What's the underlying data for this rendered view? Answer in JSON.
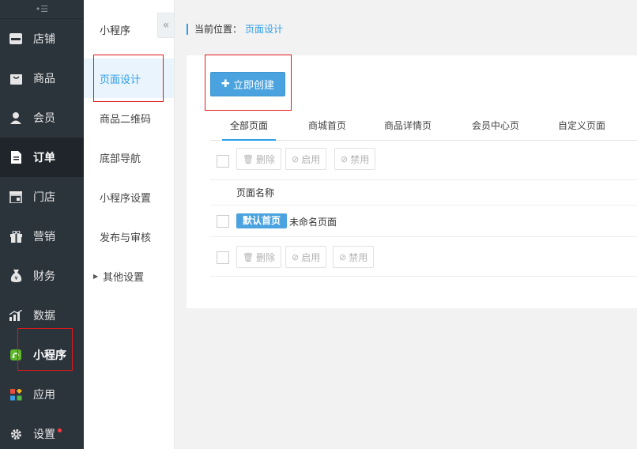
{
  "sidebar": {
    "items": [
      {
        "label": "店铺",
        "icon": "store-icon"
      },
      {
        "label": "商品",
        "icon": "goods-icon"
      },
      {
        "label": "会员",
        "icon": "member-icon"
      },
      {
        "label": "订单",
        "icon": "order-icon"
      },
      {
        "label": "门店",
        "icon": "shop-icon"
      },
      {
        "label": "营销",
        "icon": "gift-icon"
      },
      {
        "label": "财务",
        "icon": "money-bag-icon"
      },
      {
        "label": "数据",
        "icon": "chart-icon"
      },
      {
        "label": "小程序",
        "icon": "miniprogram-icon"
      },
      {
        "label": "应用",
        "icon": "apps-icon"
      },
      {
        "label": "设置",
        "icon": "gear-icon"
      }
    ]
  },
  "subnav": {
    "title": "小程序",
    "items": [
      {
        "label": "页面设计"
      },
      {
        "label": "商品二维码"
      },
      {
        "label": "底部导航"
      },
      {
        "label": "小程序设置"
      },
      {
        "label": "发布与审核"
      },
      {
        "label": "其他设置"
      }
    ]
  },
  "breadcrumb": {
    "prefix": "当前位置：",
    "current": "页面设计"
  },
  "main": {
    "create_label": "立即创建",
    "tabs": [
      {
        "label": "全部页面"
      },
      {
        "label": "商城首页"
      },
      {
        "label": "商品详情页"
      },
      {
        "label": "会员中心页"
      },
      {
        "label": "自定义页面"
      }
    ],
    "toolbar": {
      "delete_label": "删除",
      "enable_label": "启用",
      "disable_label": "禁用"
    },
    "table": {
      "header": "页面名称",
      "rows": [
        {
          "badge": "默认首页",
          "name": "未命名页面"
        }
      ]
    }
  }
}
